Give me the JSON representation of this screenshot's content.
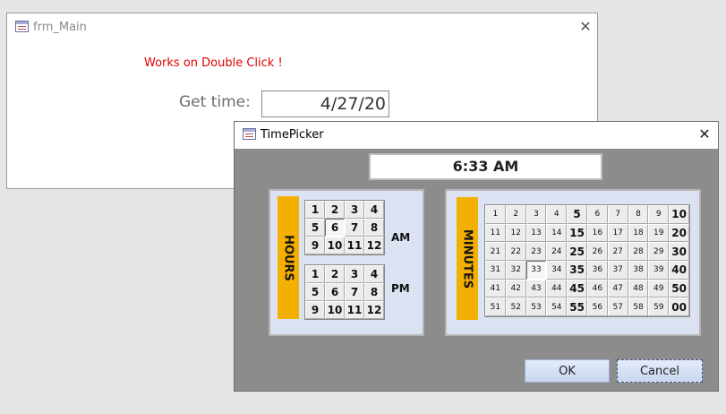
{
  "main_window": {
    "title": "frm_Main",
    "hint": "Works on Double Click !",
    "field_label": "Get time:",
    "field_value": "4/27/20"
  },
  "timepicker": {
    "title": "TimePicker",
    "time_display": "6:33 AM",
    "hours_label": "HOURS",
    "minutes_label": "MINUTES",
    "am_label": "AM",
    "pm_label": "PM",
    "am_hours": [
      "1",
      "2",
      "3",
      "4",
      "5",
      "6",
      "7",
      "8",
      "9",
      "10",
      "11",
      "12"
    ],
    "pm_hours": [
      "1",
      "2",
      "3",
      "4",
      "5",
      "6",
      "7",
      "8",
      "9",
      "10",
      "11",
      "12"
    ],
    "selected_am_hour": "6",
    "minutes": [
      "1",
      "2",
      "3",
      "4",
      "5",
      "6",
      "7",
      "8",
      "9",
      "10",
      "11",
      "12",
      "13",
      "14",
      "15",
      "16",
      "17",
      "18",
      "19",
      "20",
      "21",
      "22",
      "23",
      "24",
      "25",
      "26",
      "27",
      "28",
      "29",
      "30",
      "31",
      "32",
      "33",
      "34",
      "35",
      "36",
      "37",
      "38",
      "39",
      "40",
      "41",
      "42",
      "43",
      "44",
      "45",
      "46",
      "47",
      "48",
      "49",
      "50",
      "51",
      "52",
      "53",
      "54",
      "55",
      "56",
      "57",
      "58",
      "59",
      "00"
    ],
    "bold_minutes": [
      "5",
      "10",
      "15",
      "20",
      "25",
      "30",
      "35",
      "40",
      "45",
      "50",
      "55",
      "00"
    ],
    "selected_minute": "33",
    "ok_label": "OK",
    "cancel_label": "Cancel"
  },
  "icons": {
    "form_icon": "access-form-icon",
    "close_icon": "close-icon"
  }
}
